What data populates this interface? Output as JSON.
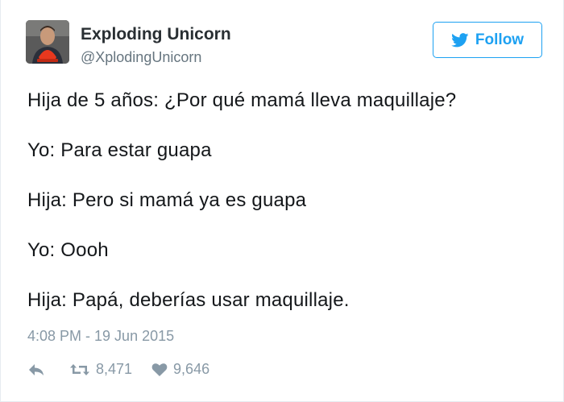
{
  "author": {
    "name": "Exploding Unicorn",
    "handle": "@XplodingUnicorn",
    "avatar_icon": "profile-photo"
  },
  "follow_button": {
    "label": "Follow",
    "icon": "twitter-bird-icon",
    "color": "#1da1f2"
  },
  "tweet": {
    "lines": [
      "Hija de 5 años: ¿Por qué mamá lleva maquillaje?",
      "Yo: Para estar guapa",
      "Hija: Pero si mamá ya es guapa",
      "Yo: Oooh",
      "Hija: Papá, deberías usar maquillaje."
    ],
    "timestamp": "4:08 PM - 19 Jun 2015"
  },
  "actions": {
    "reply_icon": "reply-icon",
    "retweet_icon": "retweet-icon",
    "retweet_count": "8,471",
    "like_icon": "heart-icon",
    "like_count": "9,646"
  }
}
